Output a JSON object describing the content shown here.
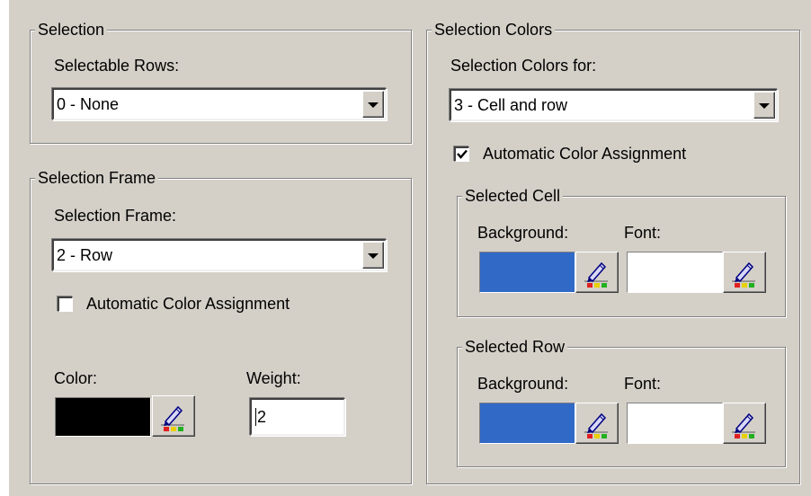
{
  "colors": {
    "dialog_bg": "#d4d0c8",
    "cell_background": "#3169c6",
    "row_background": "#3169c6",
    "cell_font": "#ffffff",
    "row_font": "#ffffff",
    "frame_color": "#000000"
  },
  "selection": {
    "group_title": "Selection",
    "rows_label": "Selectable Rows:",
    "rows_value": "0 - None"
  },
  "frame": {
    "group_title": "Selection Frame",
    "frame_label": "Selection Frame:",
    "frame_value": "2 - Row",
    "auto_color_label": "Automatic Color Assignment",
    "auto_color_checked": false,
    "color_label": "Color:",
    "weight_label": "Weight:",
    "weight_value": "2"
  },
  "colors_group": {
    "group_title": "Selection Colors",
    "for_label": "Selection Colors for:",
    "for_value": "3 - Cell and row",
    "auto_color_label": "Automatic Color Assignment",
    "auto_color_checked": true,
    "cell": {
      "group_title": "Selected Cell",
      "background_label": "Background:",
      "font_label": "Font:"
    },
    "row": {
      "group_title": "Selected Row",
      "background_label": "Background:",
      "font_label": "Font:"
    }
  },
  "icons": {
    "color_picker": "pencil-palette-icon",
    "dropdown": "chevron-down-icon",
    "check": "check-icon"
  }
}
